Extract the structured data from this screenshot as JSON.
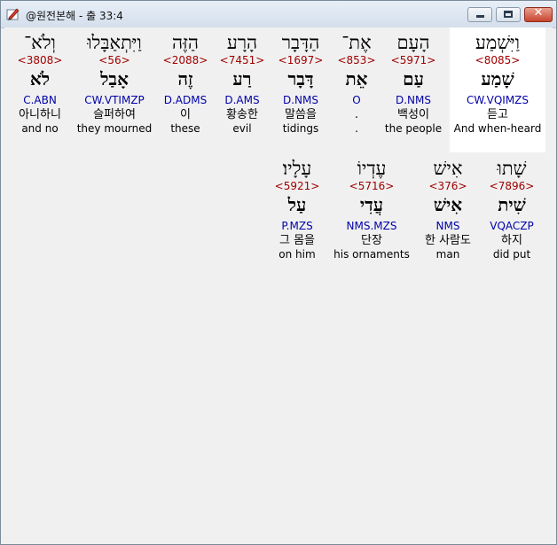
{
  "window": {
    "title": "@원전본해 - 출 33:4"
  },
  "rows": [
    [
      {
        "word": "וַיִּשְׁמַע",
        "strong": "<8085>",
        "lemma": "שָׁמַע",
        "morph": "CW.VQIMZS",
        "ko": "듣고",
        "en": "And when-heard"
      },
      {
        "word": "הָעָם",
        "strong": "<5971>",
        "lemma": "עַם",
        "morph": "D.NMS",
        "ko": "백성이",
        "en": "the people"
      },
      {
        "word": "אֶת־",
        "strong": "<853>",
        "lemma": "אֵת",
        "morph": "O",
        "ko": ".",
        "en": "."
      },
      {
        "word": "הַדָּבָר",
        "strong": "<1697>",
        "lemma": "דָּבָר",
        "morph": "D.NMS",
        "ko": "말씀을",
        "en": "tidings"
      },
      {
        "word": "הָרָע",
        "strong": "<7451>",
        "lemma": "רַע",
        "morph": "D.AMS",
        "ko": "황송한",
        "en": "evil"
      },
      {
        "word": "הַזֶּה",
        "strong": "<2088>",
        "lemma": "זֶה",
        "morph": "D.ADMS",
        "ko": "이",
        "en": "these"
      },
      {
        "word": "וַיִּתְאַבָּלוּ",
        "strong": "<56>",
        "lemma": "אָבַל",
        "morph": "CW.VTIMZP",
        "ko": "슬퍼하여",
        "en": "they mourned"
      },
      {
        "word": "וְלֹא־",
        "strong": "<3808>",
        "lemma": "לֹא",
        "morph": "C.ABN",
        "ko": "아니하니",
        "en": "and no"
      }
    ],
    [
      {
        "word": "שָׁתוּ",
        "strong": "<7896>",
        "lemma": "שִׁית",
        "morph": "VQACZP",
        "ko": "하지",
        "en": "did put"
      },
      {
        "word": "אִישׁ",
        "strong": "<376>",
        "lemma": "אִישׁ",
        "morph": "NMS",
        "ko": "한 사람도",
        "en": "man"
      },
      {
        "word": "עֶדְיוֹ",
        "strong": "<5716>",
        "lemma": "עֲדִי",
        "morph": "NMS.MZS",
        "ko": "단장",
        "en": "his ornaments"
      },
      {
        "word": "עָלָיו׃",
        "strong": "<5921>",
        "lemma": "עַל",
        "morph": "P.MZS",
        "ko": "그 몸을",
        "en": "on him"
      }
    ]
  ]
}
